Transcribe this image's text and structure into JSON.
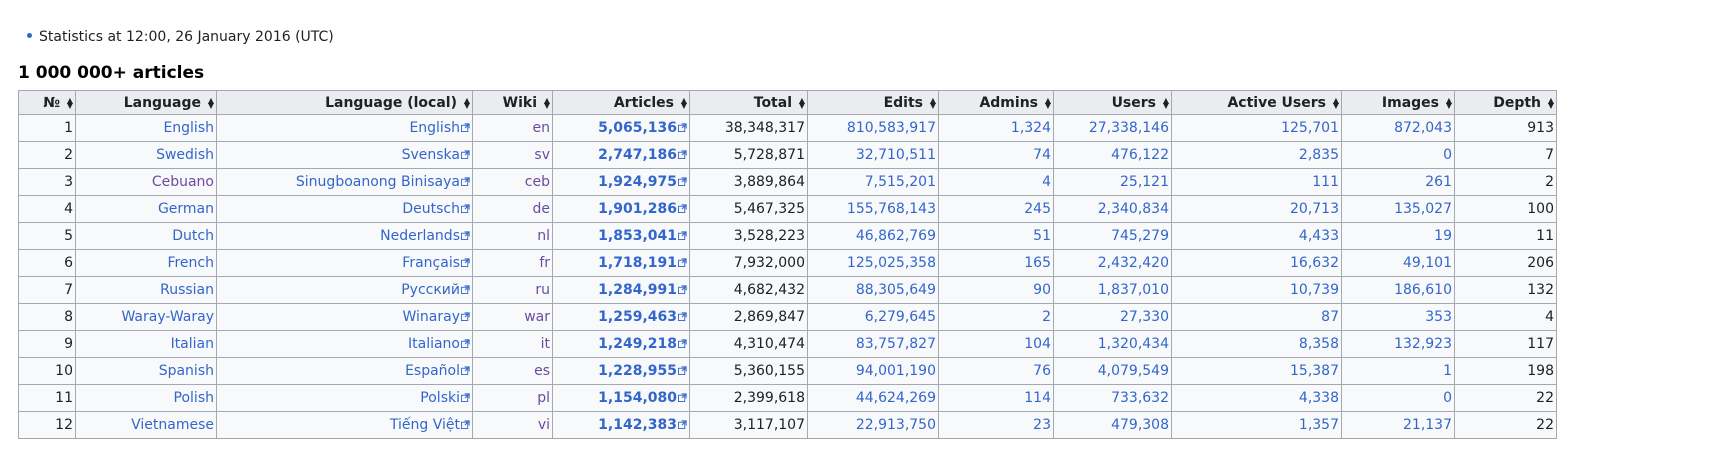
{
  "stats_text": "Statistics at 12:00, 26 January 2016 (UTC)",
  "section_heading": "1 000 000+ articles",
  "colors": {
    "link": "#3366cc",
    "visited_link": "#6b4ba1",
    "header_bg": "#eaecf0",
    "cell_bg": "#f8f9fa",
    "border": "#a2a9b1"
  },
  "icons": {
    "sort": "sort-arrows-icon",
    "external": "external-link-icon"
  },
  "table": {
    "headers": [
      "№",
      "Language",
      "Language (local)",
      "Wiki",
      "Articles",
      "Total",
      "Edits",
      "Admins",
      "Users",
      "Active Users",
      "Images",
      "Depth"
    ],
    "rows": [
      {
        "no": "1",
        "language": "English",
        "local": "English",
        "wiki": "en",
        "articles": "5,065,136",
        "total": "38,348,317",
        "edits": "810,583,917",
        "admins": "1,324",
        "users": "27,338,146",
        "active": "125,701",
        "images": "872,043",
        "depth": "913"
      },
      {
        "no": "2",
        "language": "Swedish",
        "local": "Svenska",
        "wiki": "sv",
        "articles": "2,747,186",
        "total": "5,728,871",
        "edits": "32,710,511",
        "admins": "74",
        "users": "476,122",
        "active": "2,835",
        "images": "0",
        "depth": "7"
      },
      {
        "no": "3",
        "language": "Cebuano",
        "local": "Sinugboanong Binisaya",
        "wiki": "ceb",
        "articles": "1,924,975",
        "total": "3,889,864",
        "edits": "7,515,201",
        "admins": "4",
        "users": "25,121",
        "active": "111",
        "images": "261",
        "depth": "2"
      },
      {
        "no": "4",
        "language": "German",
        "local": "Deutsch",
        "wiki": "de",
        "articles": "1,901,286",
        "total": "5,467,325",
        "edits": "155,768,143",
        "admins": "245",
        "users": "2,340,834",
        "active": "20,713",
        "images": "135,027",
        "depth": "100"
      },
      {
        "no": "5",
        "language": "Dutch",
        "local": "Nederlands",
        "wiki": "nl",
        "articles": "1,853,041",
        "total": "3,528,223",
        "edits": "46,862,769",
        "admins": "51",
        "users": "745,279",
        "active": "4,433",
        "images": "19",
        "depth": "11"
      },
      {
        "no": "6",
        "language": "French",
        "local": "Français",
        "wiki": "fr",
        "articles": "1,718,191",
        "total": "7,932,000",
        "edits": "125,025,358",
        "admins": "165",
        "users": "2,432,420",
        "active": "16,632",
        "images": "49,101",
        "depth": "206"
      },
      {
        "no": "7",
        "language": "Russian",
        "local": "Русский",
        "wiki": "ru",
        "articles": "1,284,991",
        "total": "4,682,432",
        "edits": "88,305,649",
        "admins": "90",
        "users": "1,837,010",
        "active": "10,739",
        "images": "186,610",
        "depth": "132"
      },
      {
        "no": "8",
        "language": "Waray-Waray",
        "local": "Winaray",
        "wiki": "war",
        "articles": "1,259,463",
        "total": "2,869,847",
        "edits": "6,279,645",
        "admins": "2",
        "users": "27,330",
        "active": "87",
        "images": "353",
        "depth": "4"
      },
      {
        "no": "9",
        "language": "Italian",
        "local": "Italiano",
        "wiki": "it",
        "articles": "1,249,218",
        "total": "4,310,474",
        "edits": "83,757,827",
        "admins": "104",
        "users": "1,320,434",
        "active": "8,358",
        "images": "132,923",
        "depth": "117"
      },
      {
        "no": "10",
        "language": "Spanish",
        "local": "Español",
        "wiki": "es",
        "articles": "1,228,955",
        "total": "5,360,155",
        "edits": "94,001,190",
        "admins": "76",
        "users": "4,079,549",
        "active": "15,387",
        "images": "1",
        "depth": "198"
      },
      {
        "no": "11",
        "language": "Polish",
        "local": "Polski",
        "wiki": "pl",
        "articles": "1,154,080",
        "total": "2,399,618",
        "edits": "44,624,269",
        "admins": "114",
        "users": "733,632",
        "active": "4,338",
        "images": "0",
        "depth": "22"
      },
      {
        "no": "12",
        "language": "Vietnamese",
        "local": "Tiếng Việt",
        "wiki": "vi",
        "articles": "1,142,383",
        "total": "3,117,107",
        "edits": "22,913,750",
        "admins": "23",
        "users": "479,308",
        "active": "1,357",
        "images": "21,137",
        "depth": "22"
      }
    ]
  }
}
